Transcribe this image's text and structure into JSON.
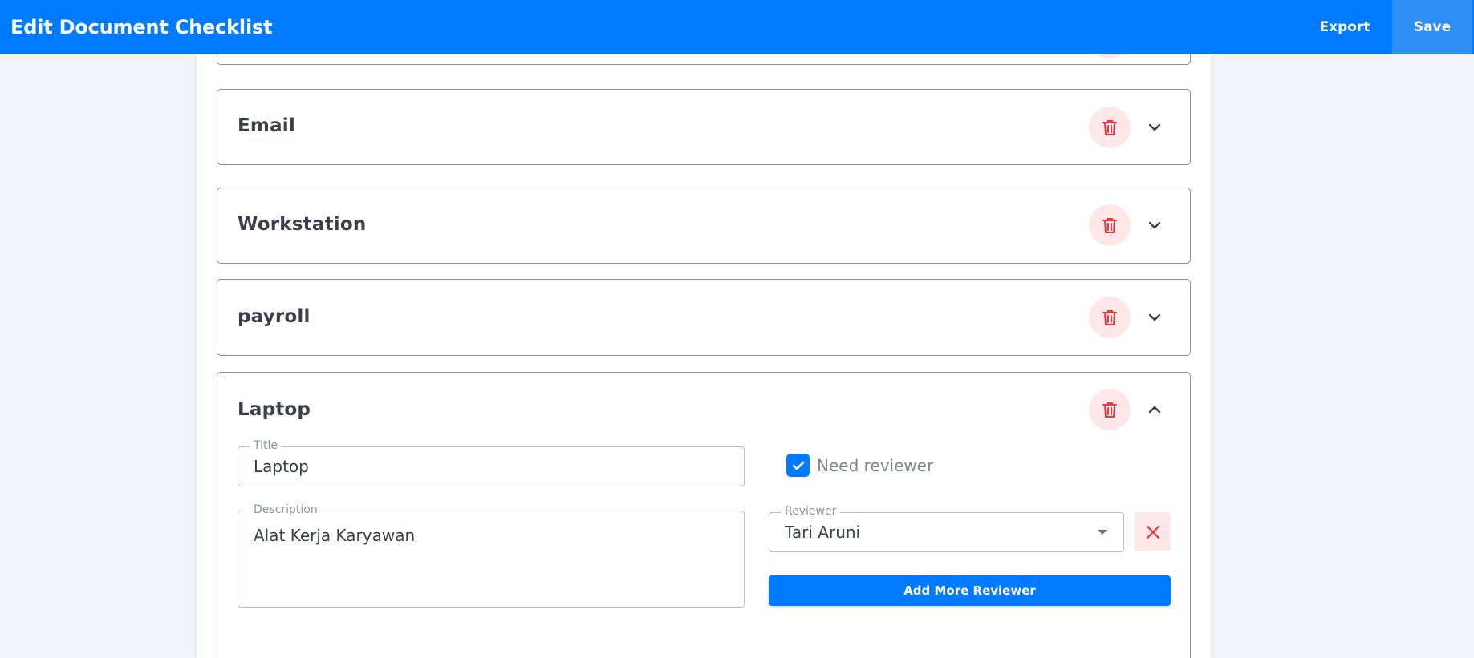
{
  "header": {
    "title": "Edit Document Checklist",
    "export_label": "Export",
    "save_label": "Save"
  },
  "checklist": {
    "items": [
      {
        "title": "",
        "expanded": false
      },
      {
        "title": "Email",
        "expanded": false
      },
      {
        "title": "Workstation",
        "expanded": false
      },
      {
        "title": "payroll",
        "expanded": false
      },
      {
        "title": "Laptop",
        "expanded": true,
        "form": {
          "title_legend": "Title",
          "title_value": "Laptop",
          "description_legend": "Description",
          "description_value": "Alat Kerja Karyawan",
          "need_reviewer_label": "Need reviewer",
          "need_reviewer_checked": true,
          "reviewer_legend": "Reviewer",
          "reviewer_value": "Tari Aruni",
          "add_reviewer_label": "Add More Reviewer"
        }
      }
    ]
  },
  "icons": {
    "delete": "trash-icon",
    "expand": "chevron-down-icon",
    "collapse": "chevron-up-icon",
    "remove": "close-icon",
    "dropdown": "caret-down-icon",
    "check": "checkmark-icon"
  },
  "colors": {
    "primary": "#007bff",
    "danger": "#e53945",
    "danger_bg": "#fde7e8",
    "background": "#f1f4f9"
  }
}
